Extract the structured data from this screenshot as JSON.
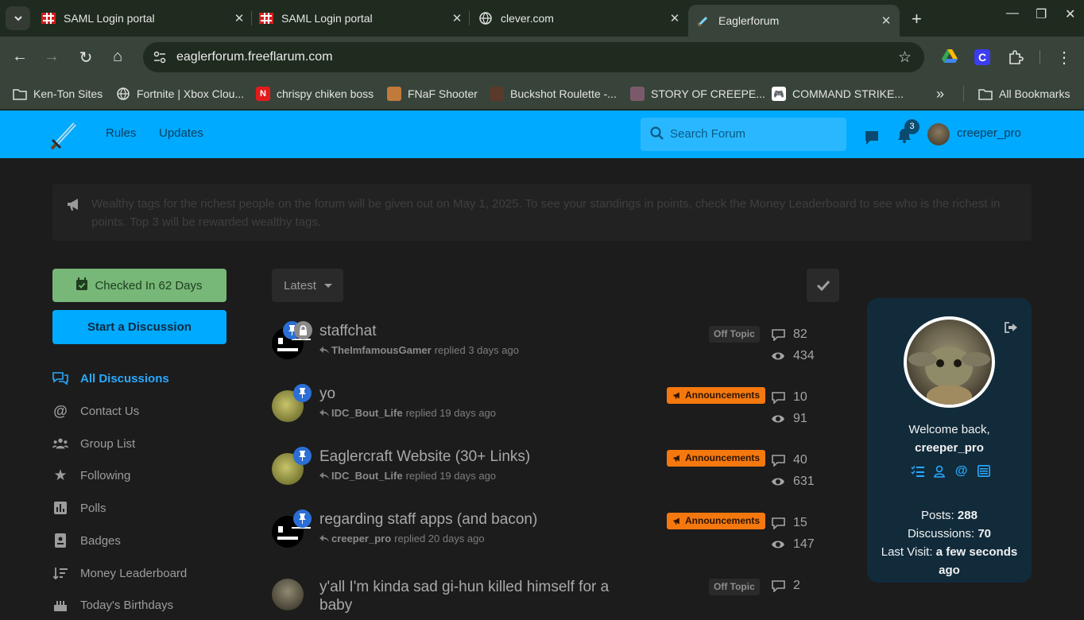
{
  "browser": {
    "tabs": [
      {
        "title": "SAML Login portal"
      },
      {
        "title": "SAML Login portal"
      },
      {
        "title": "clever.com"
      },
      {
        "title": "Eaglerforum"
      }
    ],
    "url": "eaglerforum.freeflarum.com",
    "bookmarks": [
      {
        "label": "Ken-Ton Sites"
      },
      {
        "label": "Fortnite | Xbox Clou..."
      },
      {
        "label": "chrispy chiken boss"
      },
      {
        "label": "FNaF Shooter"
      },
      {
        "label": "Buckshot Roulette -..."
      },
      {
        "label": "STORY OF CREEPE..."
      },
      {
        "label": "COMMAND STRIKE..."
      }
    ],
    "all_bookmarks": "All Bookmarks",
    "overflow": "»"
  },
  "header": {
    "nav": [
      "Rules",
      "Updates"
    ],
    "search_placeholder": "Search Forum",
    "notification_count": "3",
    "username": "creeper_pro",
    "accent": "#00aaff"
  },
  "notice": {
    "text": "Wealthy tags for the richest people on the forum will be given out on May 1, 2025. To see your standings in points, check the Money Leaderboard to see who is the richest in points. Top 3 will be rewarded wealthy tags."
  },
  "sidebar": {
    "checkin": "Checked In 62 Days",
    "start_discussion": "Start a Discussion",
    "items": [
      {
        "label": "All Discussions",
        "icon": "comments-icon"
      },
      {
        "label": "Contact Us",
        "icon": "at-icon"
      },
      {
        "label": "Group List",
        "icon": "users-icon"
      },
      {
        "label": "Following",
        "icon": "star-icon"
      },
      {
        "label": "Polls",
        "icon": "poll-icon"
      },
      {
        "label": "Badges",
        "icon": "badge-icon"
      },
      {
        "label": "Money Leaderboard",
        "icon": "sort-amount-icon"
      },
      {
        "label": "Today's Birthdays",
        "icon": "cake-icon"
      }
    ]
  },
  "list": {
    "sort": "Latest",
    "discussions": [
      {
        "title": "staffchat",
        "user": "TheImfamousGamer",
        "action": "replied 3 days ago",
        "tag": "Off Topic",
        "replies": "82",
        "views": "434"
      },
      {
        "title": "yo",
        "user": "IDC_Bout_Life",
        "action": "replied 19 days ago",
        "tag": "Announcements",
        "replies": "10",
        "views": "91"
      },
      {
        "title": "Eaglercraft Website (30+ Links)",
        "user": "IDC_Bout_Life",
        "action": "replied 19 days ago",
        "tag": "Announcements",
        "replies": "40",
        "views": "631"
      },
      {
        "title": "regarding staff apps (and bacon)",
        "user": "creeper_pro",
        "action": "replied 20 days ago",
        "tag": "Announcements",
        "replies": "15",
        "views": "147"
      },
      {
        "title": "y'all I'm kinda sad gi-hun killed himself for a baby",
        "tag": "Off Topic",
        "replies": "2"
      }
    ]
  },
  "user_card": {
    "welcome": "Welcome back,",
    "username": "creeper_pro",
    "posts_label": "Posts:",
    "posts": "288",
    "discussions_label": "Discussions:",
    "discussions": "70",
    "last_visit_label": "Last Visit:",
    "last_visit": "a few seconds ago"
  }
}
